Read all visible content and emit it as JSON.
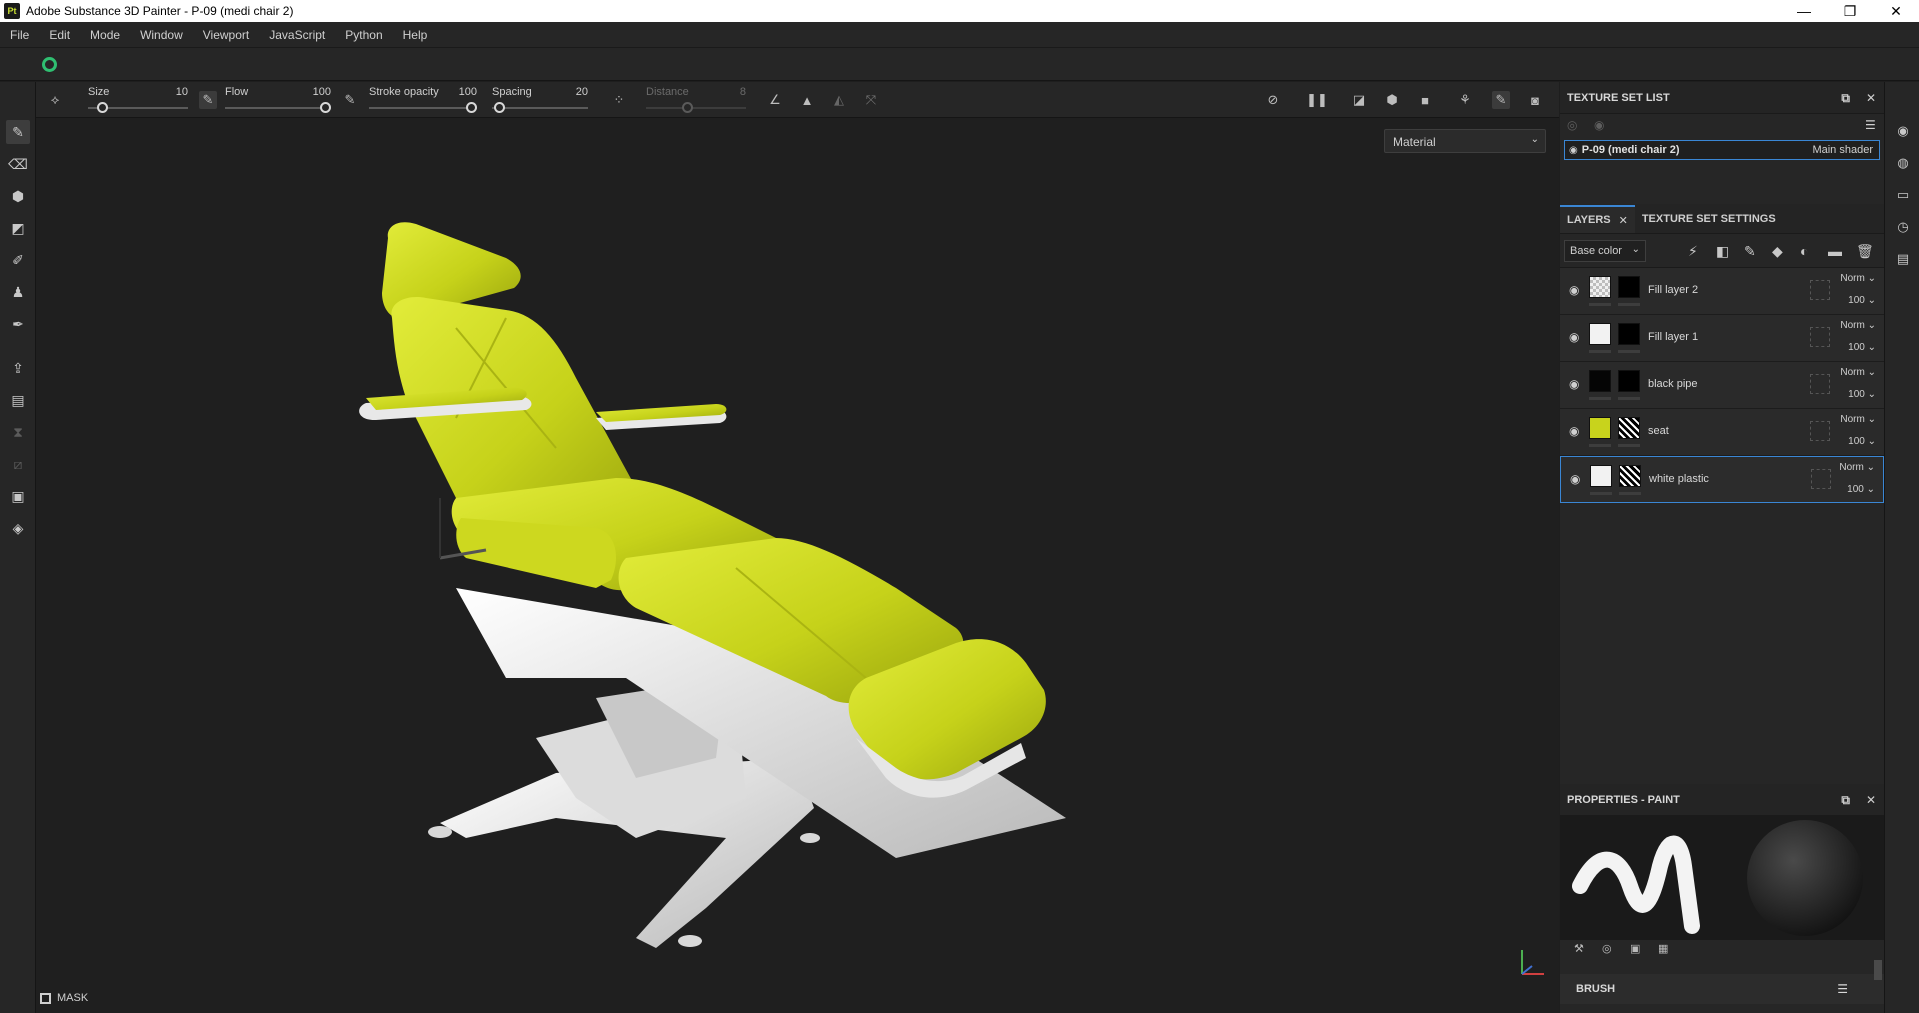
{
  "window": {
    "title": "Adobe Substance 3D Painter - P-09 (medi chair 2)",
    "app_icon_text": "Pt",
    "controls": [
      "—",
      "❐",
      "✕"
    ]
  },
  "menu": {
    "items": [
      "File",
      "Edit",
      "Mode",
      "Window",
      "Viewport",
      "JavaScript",
      "Python",
      "Help"
    ]
  },
  "tool_options": {
    "size": {
      "label": "Size",
      "value": "10",
      "fraction": 0.1
    },
    "flow": {
      "label": "Flow",
      "value": "100",
      "fraction": 1.0
    },
    "stroke_opacity": {
      "label": "Stroke opacity",
      "value": "100",
      "fraction": 1.0
    },
    "spacing": {
      "label": "Spacing",
      "value": "20",
      "fraction": 0.02
    },
    "distance": {
      "label": "Distance",
      "value": "8",
      "fraction": 0.4,
      "disabled": true
    }
  },
  "viewport": {
    "material_mode": "Material",
    "mask_label": "MASK",
    "accent_yellow": "#c8d31c",
    "plastic_white": "#e4e4e4"
  },
  "texture_set_list": {
    "title": "TEXTURE SET LIST",
    "set_name": "P-09 (medi chair 2)",
    "shader": "Main shader"
  },
  "layers_panel": {
    "tabs": [
      "LAYERS",
      "TEXTURE SET SETTINGS"
    ],
    "channel": "Base color",
    "layers": [
      {
        "name": "Fill layer 2",
        "blend": "Norm",
        "opacity": "100",
        "thumb": "checker",
        "mask": "black",
        "selected": false
      },
      {
        "name": "Fill layer 1",
        "blend": "Norm",
        "opacity": "100",
        "thumb": "white",
        "mask": "black",
        "selected": false
      },
      {
        "name": "black pipe",
        "blend": "Norm",
        "opacity": "100",
        "thumb": "black",
        "mask": "black",
        "selected": false
      },
      {
        "name": "seat",
        "blend": "Norm",
        "opacity": "100",
        "thumb": "yellow",
        "mask": "pattern",
        "selected": false
      },
      {
        "name": "white plastic",
        "blend": "Norm",
        "opacity": "100",
        "thumb": "white",
        "mask": "pattern",
        "selected": true
      }
    ]
  },
  "properties": {
    "title": "PROPERTIES - PAINT",
    "brush_label": "BRUSH"
  }
}
